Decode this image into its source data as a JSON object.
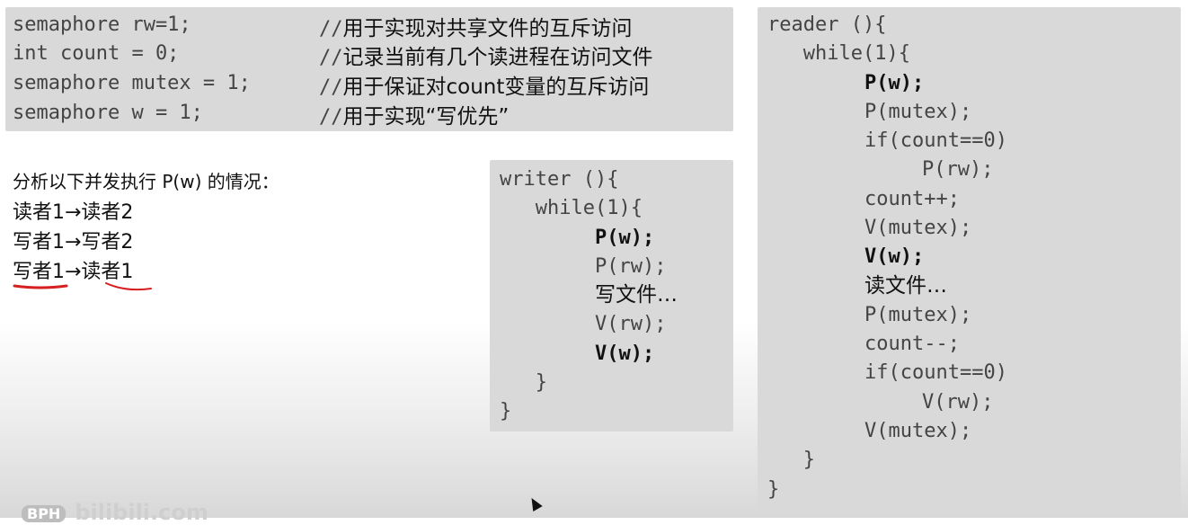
{
  "declarations": [
    {
      "code": "semaphore rw=1;",
      "comment_prefix": "//",
      "comment": "用于实现对共享文件的互斥访问"
    },
    {
      "code": "int count = 0;",
      "comment_prefix": "//",
      "comment": "记录当前有几个读进程在访问文件"
    },
    {
      "code": "semaphore mutex = 1;",
      "comment_prefix": "//",
      "comment": "用于保证对count变量的互斥访问"
    },
    {
      "code": "semaphore w = 1;",
      "comment_prefix": "//",
      "comment": "用于实现“写优先”"
    }
  ],
  "analysis": {
    "title": "分析以下并发执行 P(w) 的情况：",
    "cases": [
      "读者1→读者2",
      "写者1→写者2",
      "写者1→读者1"
    ]
  },
  "writer": [
    "writer (){",
    "   while(1){",
    "P(w);",
    "P(rw);",
    "写文件…",
    "V(rw);",
    "V(w);",
    "   }",
    "}"
  ],
  "reader": [
    "reader (){",
    "   while(1){",
    "P(w);",
    "P(mutex);",
    "if(count==0)",
    "P(rw);",
    "count++;",
    "V(mutex);",
    "V(w);",
    "读文件…",
    "P(mutex);",
    "count--;",
    "if(count==0)",
    "V(rw);",
    "V(mutex);",
    "   }",
    "}"
  ],
  "watermark": {
    "logo": "BPH",
    "text": "bilibili.com"
  },
  "colors": {
    "panel": "#d9d9d9",
    "underline": "#d62020"
  }
}
